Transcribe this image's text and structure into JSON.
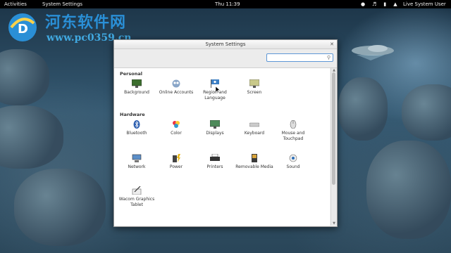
{
  "topbar": {
    "activities": "Activities",
    "app_menu": "System Settings",
    "clock": "Thu 11:39",
    "user": "Live System User",
    "tray_icons": [
      "accessibility-icon",
      "volume-icon",
      "battery-icon",
      "network-icon"
    ]
  },
  "watermark": {
    "title": "河东软件网",
    "url": "www.pc0359.cn"
  },
  "window": {
    "title": "System Settings",
    "search": {
      "value": "",
      "placeholder": ""
    },
    "sections": [
      {
        "label": "Personal",
        "items": [
          {
            "label": "Background",
            "icon": "background-icon"
          },
          {
            "label": "Online Accounts",
            "icon": "online-accounts-icon"
          },
          {
            "label": "Region and Language",
            "icon": "region-language-icon"
          },
          {
            "label": "Screen",
            "icon": "screen-icon"
          }
        ]
      },
      {
        "label": "Hardware",
        "items": [
          {
            "label": "Bluetooth",
            "icon": "bluetooth-icon"
          },
          {
            "label": "Color",
            "icon": "color-icon"
          },
          {
            "label": "Displays",
            "icon": "displays-icon"
          },
          {
            "label": "Keyboard",
            "icon": "keyboard-icon"
          },
          {
            "label": "Mouse and Touchpad",
            "icon": "mouse-icon"
          },
          {
            "label": "Network",
            "icon": "network-icon"
          },
          {
            "label": "Power",
            "icon": "power-icon"
          },
          {
            "label": "Printers",
            "icon": "printer-icon"
          },
          {
            "label": "Removable Media",
            "icon": "removable-media-icon"
          },
          {
            "label": "Sound",
            "icon": "sound-icon"
          },
          {
            "label": "Wacom Graphics Tablet",
            "icon": "wacom-tablet-icon"
          }
        ]
      }
    ]
  },
  "colors": {
    "accent": "#2a8fd6",
    "topbar": "#000000",
    "window_bg": "#f2f2f2"
  }
}
